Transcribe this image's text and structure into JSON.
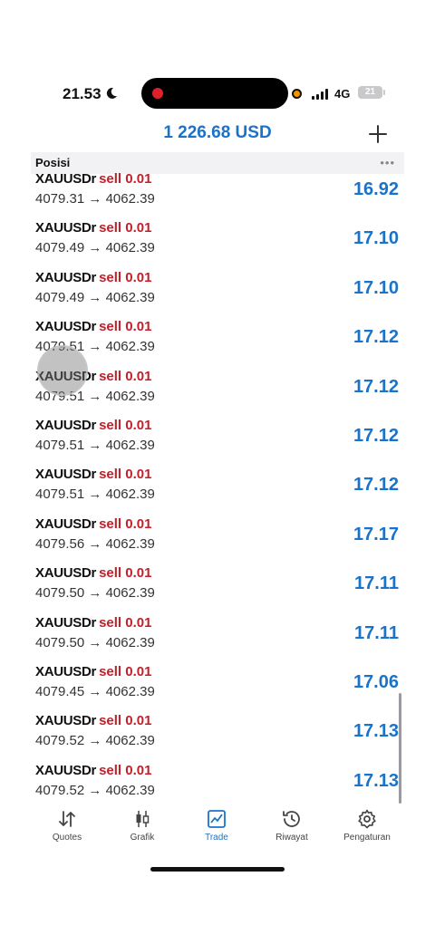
{
  "status_bar": {
    "time": "21.53",
    "network": "4G",
    "battery": "21",
    "icons": [
      "moon-icon",
      "recording-dot-icon",
      "privacy-dot-icon",
      "signal-icon",
      "battery-icon"
    ]
  },
  "header": {
    "balance": "1 226.68 USD",
    "plus_icon": "plus-icon"
  },
  "section": {
    "title": "Posisi",
    "more_icon": "more-dots-icon"
  },
  "positions": [
    {
      "symbol": "XAUUSDr",
      "side": "sell",
      "volume": "0.01",
      "open": "4079.31",
      "arrow": "→",
      "current": "4062.39",
      "profit": "16.92"
    },
    {
      "symbol": "XAUUSDr",
      "side": "sell",
      "volume": "0.01",
      "open": "4079.49",
      "arrow": "→",
      "current": "4062.39",
      "profit": "17.10"
    },
    {
      "symbol": "XAUUSDr",
      "side": "sell",
      "volume": "0.01",
      "open": "4079.49",
      "arrow": "→",
      "current": "4062.39",
      "profit": "17.10"
    },
    {
      "symbol": "XAUUSDr",
      "side": "sell",
      "volume": "0.01",
      "open": "4079.51",
      "arrow": "→",
      "current": "4062.39",
      "profit": "17.12"
    },
    {
      "symbol": "XAUUSDr",
      "side": "sell",
      "volume": "0.01",
      "open": "4079.51",
      "arrow": "→",
      "current": "4062.39",
      "profit": "17.12"
    },
    {
      "symbol": "XAUUSDr",
      "side": "sell",
      "volume": "0.01",
      "open": "4079.51",
      "arrow": "→",
      "current": "4062.39",
      "profit": "17.12"
    },
    {
      "symbol": "XAUUSDr",
      "side": "sell",
      "volume": "0.01",
      "open": "4079.51",
      "arrow": "→",
      "current": "4062.39",
      "profit": "17.12"
    },
    {
      "symbol": "XAUUSDr",
      "side": "sell",
      "volume": "0.01",
      "open": "4079.56",
      "arrow": "→",
      "current": "4062.39",
      "profit": "17.17"
    },
    {
      "symbol": "XAUUSDr",
      "side": "sell",
      "volume": "0.01",
      "open": "4079.50",
      "arrow": "→",
      "current": "4062.39",
      "profit": "17.11"
    },
    {
      "symbol": "XAUUSDr",
      "side": "sell",
      "volume": "0.01",
      "open": "4079.50",
      "arrow": "→",
      "current": "4062.39",
      "profit": "17.11"
    },
    {
      "symbol": "XAUUSDr",
      "side": "sell",
      "volume": "0.01",
      "open": "4079.45",
      "arrow": "→",
      "current": "4062.39",
      "profit": "17.06"
    },
    {
      "symbol": "XAUUSDr",
      "side": "sell",
      "volume": "0.01",
      "open": "4079.52",
      "arrow": "→",
      "current": "4062.39",
      "profit": "17.13"
    },
    {
      "symbol": "XAUUSDr",
      "side": "sell",
      "volume": "0.01",
      "open": "4079.52",
      "arrow": "→",
      "current": "4062.39",
      "profit": "17.13"
    }
  ],
  "tabs": [
    {
      "label": "Quotes",
      "icon": "quotes-arrows-icon",
      "active": false
    },
    {
      "label": "Grafik",
      "icon": "candlestick-icon",
      "active": false
    },
    {
      "label": "Trade",
      "icon": "trade-chart-icon",
      "active": true
    },
    {
      "label": "Riwayat",
      "icon": "history-clock-icon",
      "active": false
    },
    {
      "label": "Pengaturan",
      "icon": "settings-gear-icon",
      "active": false
    }
  ],
  "colors": {
    "accent": "#1a73c9",
    "sell": "#c0202a",
    "section_bg": "#f2f2f4"
  }
}
